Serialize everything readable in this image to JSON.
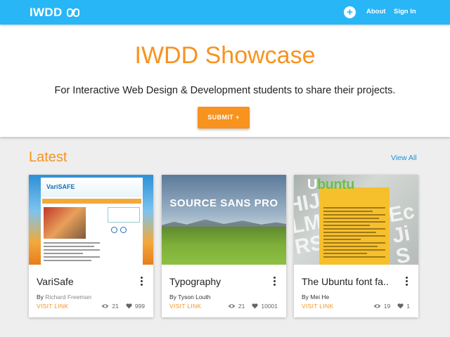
{
  "header": {
    "brand": "IWDD",
    "nav": {
      "about": "About",
      "sign_in": "Sign In"
    }
  },
  "hero": {
    "title": "IWDD Showcase",
    "subtitle": "For Interactive Web Design & Development students to share their projects.",
    "submit_label": "SUBMIT +"
  },
  "latest": {
    "title": "Latest",
    "view_all": "View All",
    "cards": [
      {
        "title": "VariSafe",
        "by": "By",
        "author": "Richard Freeman",
        "visit": "VISIT LINK",
        "views": "21",
        "likes": "999",
        "image_text": "VariSAFE"
      },
      {
        "title": "Typography",
        "by": "By",
        "author": "Tyson Louth",
        "visit": "VISIT LINK",
        "views": "21",
        "likes": "10001",
        "image_text": "SOURCE SANS PRO"
      },
      {
        "title": "The Ubuntu font fa...",
        "by": "By",
        "author": "Mei He",
        "visit": "VISIT LINK",
        "views": "19",
        "likes": "1",
        "image_text": "Ubuntu"
      }
    ]
  },
  "colors": {
    "topbar": "#29b6f6",
    "accent": "#f7931e",
    "link": "#1e8fcf"
  },
  "icons": [
    "link-logo-icon",
    "plus-icon",
    "more-vert-icon",
    "eye-icon",
    "heart-icon"
  ]
}
